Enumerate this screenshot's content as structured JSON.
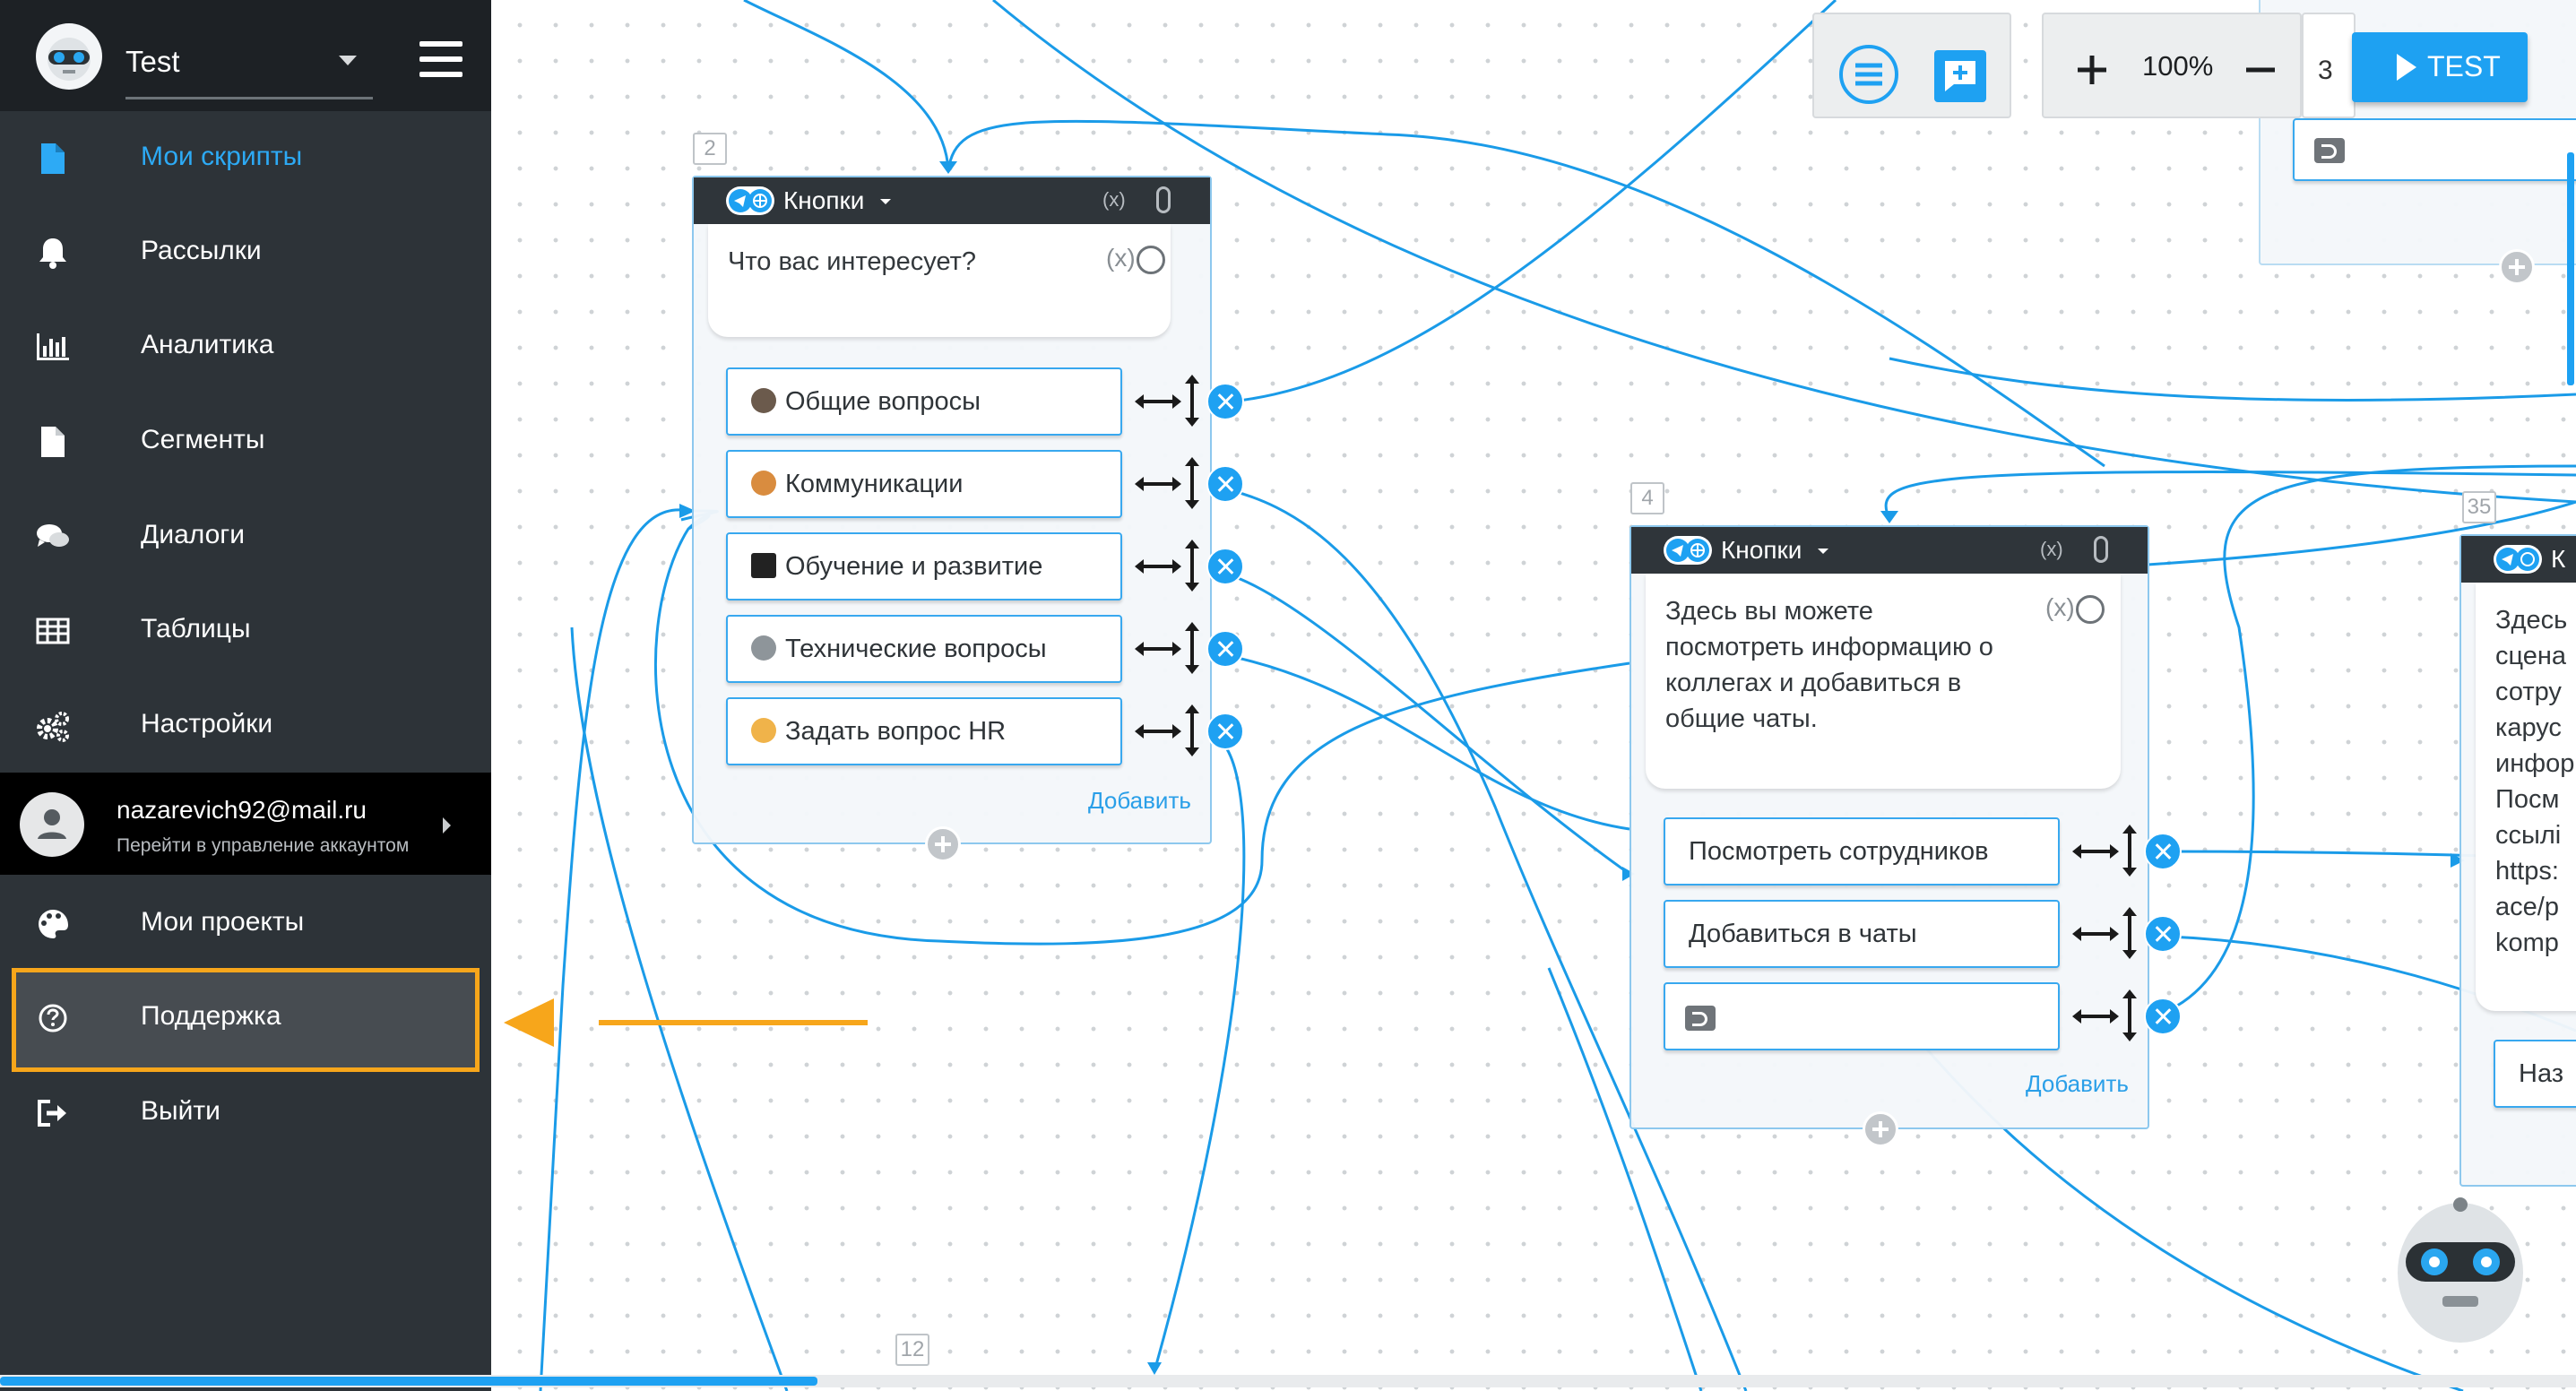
{
  "sidebar": {
    "project_name": "Test",
    "nav": [
      {
        "label": "Мои скрипты",
        "icon": "file-icon",
        "active": true
      },
      {
        "label": "Рассылки",
        "icon": "bell-icon"
      },
      {
        "label": "Аналитика",
        "icon": "bar-chart-icon"
      },
      {
        "label": "Сегменты",
        "icon": "document-icon"
      },
      {
        "label": "Диалоги",
        "icon": "chat-bubbles-icon"
      },
      {
        "label": "Таблицы",
        "icon": "table-icon"
      },
      {
        "label": "Настройки",
        "icon": "gears-icon"
      }
    ],
    "account": {
      "email": "nazarevich92@mail.ru",
      "subtitle": "Перейти в управление аккаунтом"
    },
    "nav2": [
      {
        "label": "Мои проекты",
        "icon": "palette-icon"
      },
      {
        "label": "Поддержка",
        "icon": "help-circle-icon"
      },
      {
        "label": "Выйти",
        "icon": "logout-icon"
      }
    ]
  },
  "toolbar": {
    "zoom": "100%",
    "test_label": "TEST",
    "partial_text": "3"
  },
  "colors": {
    "accent": "#1ea1f2",
    "sidebar": "#2d3338",
    "highlight": "#f7a61b",
    "wire": "#1a9be8"
  },
  "nodes": {
    "n2": {
      "id": "2",
      "type": "Кнопки",
      "var": "(x)",
      "message": "Что вас интересует?",
      "buttons": [
        "Общие вопросы",
        "Коммуникации",
        "Обучение и развитие",
        "Технические вопросы",
        "Задать вопрос HR"
      ],
      "add": "Добавить"
    },
    "n4": {
      "id": "4",
      "type": "Кнопки",
      "var": "(x)",
      "message_lines": [
        "Здесь вы можете",
        "посмотреть информацию о",
        "коллегах и добавиться в",
        "общие чаты."
      ],
      "buttons": [
        "Посмотреть сотрудников",
        "Добавиться в чаты",
        ""
      ],
      "add": "Добавить"
    },
    "n35": {
      "id": "35",
      "type": "К",
      "message_lines": [
        "Здесь",
        "сцена",
        "сотру",
        "карус",
        "инфор",
        "Посм",
        "ссылі",
        "https:",
        "ace/p",
        "komp"
      ],
      "button": "Наз"
    },
    "n12": {
      "id": "12"
    }
  }
}
